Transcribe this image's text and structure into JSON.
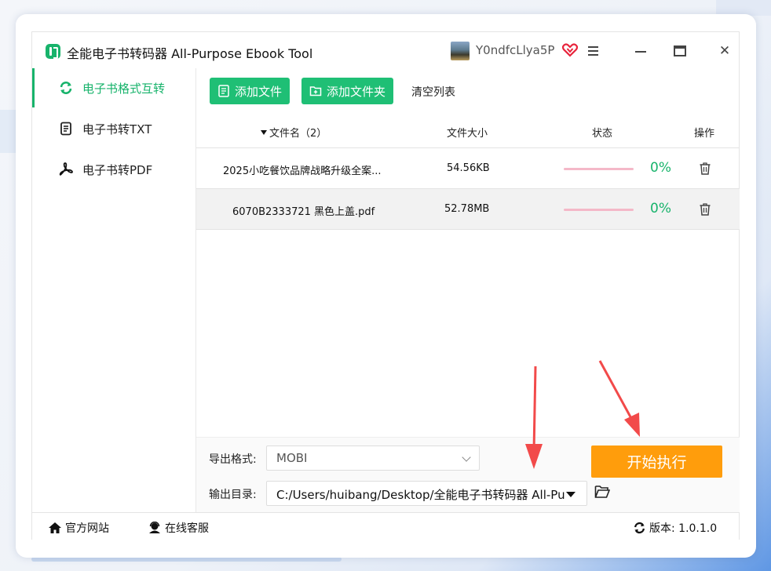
{
  "window": {
    "title": "全能电子书转码器 All-Purpose Ebook Tool",
    "username": "Y0ndfcLlya5P"
  },
  "sidebar": {
    "items": [
      {
        "label": "电子书格式互转",
        "icon": "refresh-icon",
        "active": true
      },
      {
        "label": "电子书转TXT",
        "icon": "document-icon",
        "active": false
      },
      {
        "label": "电子书转PDF",
        "icon": "pdf-icon",
        "active": false
      }
    ]
  },
  "toolbar": {
    "add_file": "添加文件",
    "add_folder": "添加文件夹",
    "clear_list": "清空列表"
  },
  "table": {
    "headers": {
      "filename": "文件名（2）",
      "size": "文件大小",
      "status": "状态",
      "action": "操作"
    },
    "rows": [
      {
        "name": "2025小吃餐饮品牌战略升级全案...",
        "size": "54.56KB",
        "progress": "0%",
        "progress_value": 0
      },
      {
        "name": "6070B2333721 黑色上盖.pdf",
        "size": "52.78MB",
        "progress": "0%",
        "progress_value": 0
      }
    ]
  },
  "options": {
    "format_label": "导出格式:",
    "format_value": "MOBI",
    "dir_label": "输出目录:",
    "dir_value": "C:/Users/huibang/Desktop/全能电子书转码器 All-Pu",
    "start_button": "开始执行"
  },
  "footer": {
    "website": "官方网站",
    "support": "在线客服",
    "version": "版本: 1.0.1.0"
  },
  "colors": {
    "accent": "#17b36b",
    "start": "#ff9d0c",
    "progress_track": "#f4b8c8",
    "arrow": "#f24a4a"
  }
}
